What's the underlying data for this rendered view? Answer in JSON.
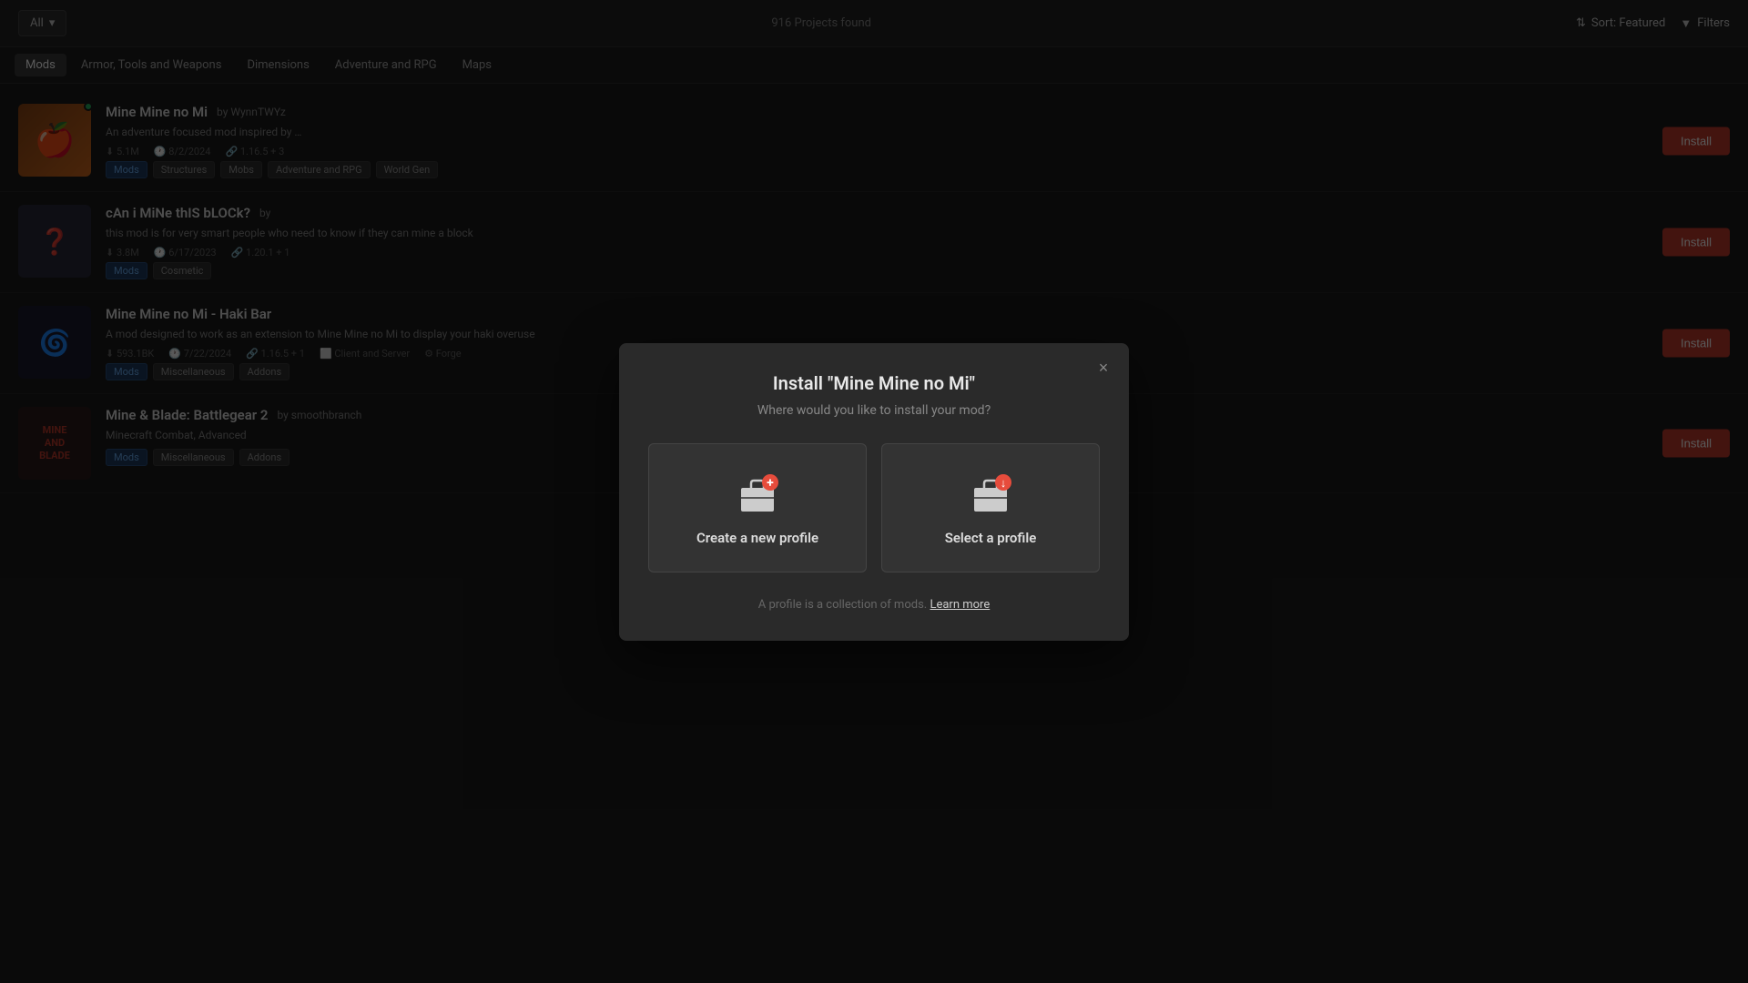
{
  "topbar": {
    "filter_label": "All",
    "chevron": "▾",
    "projects_count": "916 Projects found",
    "sort_icon": "≡",
    "sort_label": "Sort: Featured",
    "filter_icon": "⊟",
    "filter_label_right": "Filters"
  },
  "categories": [
    {
      "id": "mods",
      "label": "Mods",
      "active": true
    },
    {
      "id": "armor",
      "label": "Armor, Tools and Weapons",
      "active": false
    },
    {
      "id": "dimensions",
      "label": "Dimensions",
      "active": false
    },
    {
      "id": "adventure",
      "label": "Adventure and RPG",
      "active": false
    },
    {
      "id": "maps",
      "label": "Maps",
      "active": false
    }
  ],
  "mods": [
    {
      "id": 1,
      "title": "Mine Mine no Mi",
      "author": "by WynnTWYz",
      "desc": "An adventure focused mod inspired by …",
      "downloads": "5.1M",
      "date": "8/2/2024",
      "version": "1.16.5 + 3",
      "tags": [
        "Mods",
        "Structures",
        "Mobs",
        "Adventure and RPG",
        "World Gen"
      ],
      "has_online": true,
      "thumb_emoji": "🍎",
      "thumb_class": "thumb-bg-1"
    },
    {
      "id": 2,
      "title": "cAn i MiNe thIS bLOCk?",
      "author": "by ",
      "desc": "this mod is for very smart people who need to know if they can mine a block",
      "downloads": "3.8M",
      "date": "6/17/2023",
      "version": "1.20.1 + 1",
      "tags": [
        "Mods",
        "Cosmetic"
      ],
      "has_online": false,
      "thumb_emoji": "❓",
      "thumb_class": "thumb-bg-2"
    },
    {
      "id": 3,
      "title": "Mine Mine no Mi - Haki Bar",
      "author": "by ",
      "desc": "A mod designed to work as an extension to Mine Mine no Mi to display your haki overuse",
      "downloads": "593.1BK",
      "date": "7/22/2024",
      "version": "1.16.5 + 1",
      "tags": [
        "Mods",
        "Miscellaneous",
        "Addons"
      ],
      "extra_tags": [
        "Client and Server",
        "Forge"
      ],
      "has_online": false,
      "thumb_emoji": "🌀",
      "thumb_class": "thumb-bg-3"
    },
    {
      "id": 4,
      "title": "Mine & Blade: Battlegear 2",
      "author": "by smoothbranch",
      "desc": "Minecraft Combat, Advanced",
      "downloads": "",
      "date": "",
      "version": "",
      "tags": [
        "Mods",
        "Miscellaneous",
        "Addons"
      ],
      "has_online": false,
      "thumb_emoji": "⚔",
      "thumb_class": "thumb-bg-4",
      "logo_text": "MINE\nAND\nBLADE"
    }
  ],
  "modal": {
    "title": "Install \"Mine Mine no Mi\"",
    "subtitle": "Where would you like to install your mod?",
    "option1_label": "Create a new profile",
    "option2_label": "Select a profile",
    "footer_text": "A profile is a collection of mods.",
    "footer_link": "Learn more",
    "close_label": "×"
  }
}
